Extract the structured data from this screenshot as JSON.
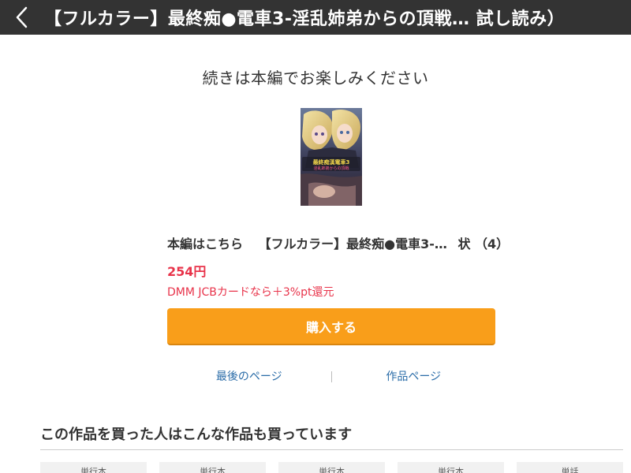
{
  "header": {
    "title": "【フルカラー】最終痴●電車3-淫乱姉弟からの頂戦… 試し読み）"
  },
  "main": {
    "continue_message": "続きは本編でお楽しみください",
    "cover_title_art": "最終痴漢電車3 淫乱姉弟からの頂戦",
    "product": {
      "prefix": "本編はこちら",
      "name": "【フルカラー】最終痴●電車3-…",
      "suffix": "状 （4）"
    },
    "price": "254円",
    "campaign": "DMM JCBカードなら＋3%pt還元",
    "buy_button": "購入する",
    "links": {
      "last_page": "最後のページ",
      "work_page": "作品ページ"
    }
  },
  "recommendations": {
    "heading": "この作品を買った人はこんな作品も買っています",
    "cards": [
      {
        "label": "単行本"
      },
      {
        "label": "単行本"
      },
      {
        "label": "単行本"
      },
      {
        "label": "単行本"
      },
      {
        "label": "単話"
      }
    ]
  },
  "colors": {
    "header_bg": "#333333",
    "accent_price": "#e8334a",
    "buy_button": "#f99e1a",
    "link": "#2a6ca8"
  },
  "icons": {
    "back": "chevron-left-icon"
  }
}
